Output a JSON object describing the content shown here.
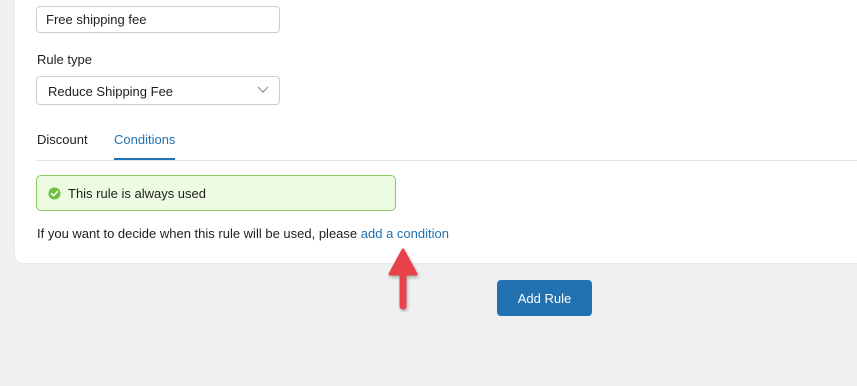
{
  "form": {
    "name_value": "Free shipping fee",
    "rule_type_label": "Rule type",
    "rule_type_value": "Reduce Shipping Fee"
  },
  "tabs": [
    {
      "label": "Discount",
      "active": false
    },
    {
      "label": "Conditions",
      "active": true
    }
  ],
  "conditions": {
    "notice_text": "This rule is always used",
    "help_text": "If you want to decide when this rule will be used, please",
    "help_link": "add a condition"
  },
  "actions": {
    "add_rule_label": "Add Rule"
  },
  "icons": {
    "select": "chevron-down-icon",
    "notice": "check-circle-icon",
    "annotation": "red-arrow-up-icon"
  },
  "colors": {
    "accent": "#2271b1",
    "success": "#6fbf3f",
    "annotation": "#e8434c"
  }
}
